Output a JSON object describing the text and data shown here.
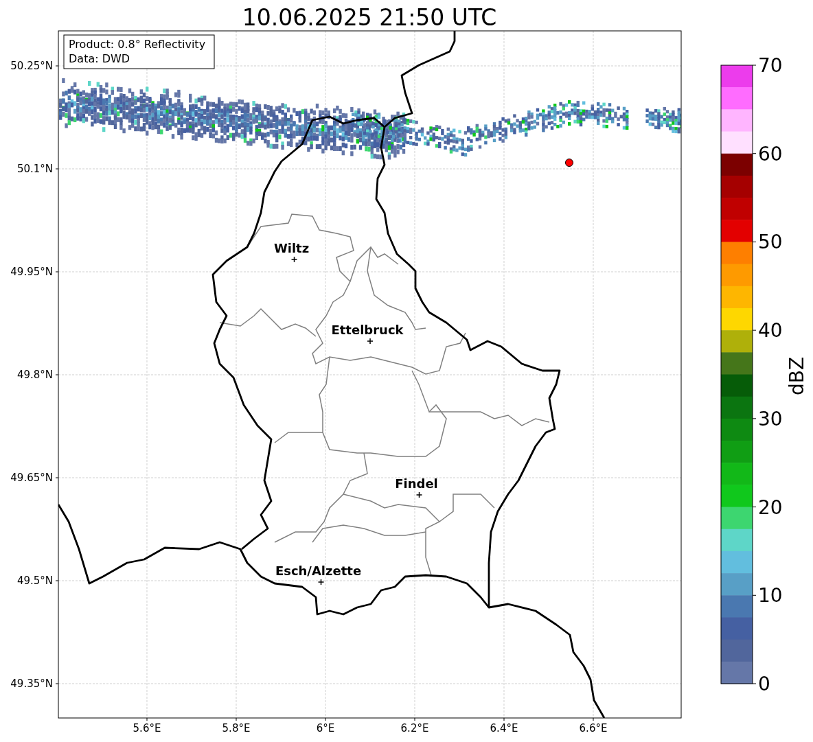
{
  "title": "10.06.2025 21:50 UTC",
  "info_box": {
    "lines": [
      "Product: 0.8° Reflectivity",
      "Data: DWD"
    ]
  },
  "map": {
    "x_ticks": [
      "5.6°E",
      "5.8°E",
      "6°E",
      "6.2°E",
      "6.4°E",
      "6.6°E"
    ],
    "y_ticks": [
      "50.25°N",
      "50.1°N",
      "49.95°N",
      "49.8°N",
      "49.65°N",
      "49.5°N",
      "49.35°N"
    ],
    "places": [
      {
        "name": "Wiltz"
      },
      {
        "name": "Ettelbruck"
      },
      {
        "name": "Findel"
      },
      {
        "name": "Esch/Alzette"
      }
    ]
  },
  "colorbar": {
    "label": "dBZ",
    "ticks": [
      "70",
      "60",
      "50",
      "40",
      "30",
      "20",
      "10",
      "0"
    ],
    "bins": [
      {
        "color": "#ec3cec"
      },
      {
        "color": "#ff6cff"
      },
      {
        "color": "#ffb5ff"
      },
      {
        "color": "#ffe0ff"
      },
      {
        "color": "#7c0000"
      },
      {
        "color": "#a50000"
      },
      {
        "color": "#c00000"
      },
      {
        "color": "#e30000"
      },
      {
        "color": "#fe7f00"
      },
      {
        "color": "#fe9a00"
      },
      {
        "color": "#feb600"
      },
      {
        "color": "#fed700"
      },
      {
        "color": "#afb00a"
      },
      {
        "color": "#45761a"
      },
      {
        "color": "#065c08"
      },
      {
        "color": "#0b7510"
      },
      {
        "color": "#0e8a12"
      },
      {
        "color": "#109e14"
      },
      {
        "color": "#12b818"
      },
      {
        "color": "#10c81c"
      },
      {
        "color": "#3dd670"
      },
      {
        "color": "#5ed6c8"
      },
      {
        "color": "#62bede"
      },
      {
        "color": "#589fc6"
      },
      {
        "color": "#4a78b0"
      },
      {
        "color": "#4560a2"
      },
      {
        "color": "#51669c"
      },
      {
        "color": "#6577a8"
      }
    ]
  }
}
